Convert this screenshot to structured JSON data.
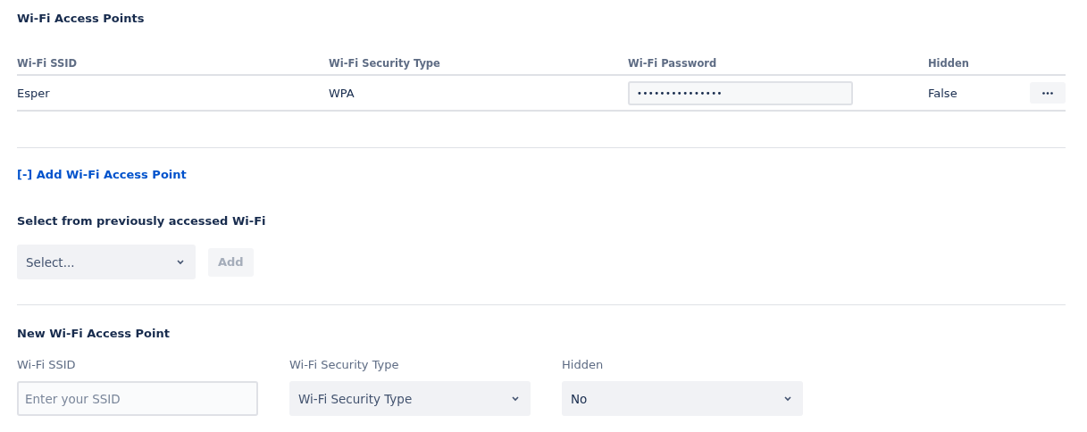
{
  "access_points": {
    "title": "Wi-Fi Access Points",
    "columns": [
      "Wi-Fi SSID",
      "Wi-Fi Security Type",
      "Wi-Fi Password",
      "Hidden"
    ],
    "rows": [
      {
        "ssid": "Esper",
        "security": "WPA",
        "password": "•••••••••••••••",
        "hidden": "False"
      }
    ]
  },
  "add_link": "[-] Add Wi-Fi Access Point",
  "previous": {
    "label": "Select from previously accessed Wi-Fi",
    "select": {
      "placeholder": "Select..."
    },
    "button": {
      "label": "Add",
      "disabled": true
    }
  },
  "new_point": {
    "title": "New Wi-Fi Access Point",
    "fields": [
      {
        "kind": "input",
        "label": "Wi-Fi SSID",
        "placeholder": "Enter your SSID"
      },
      {
        "kind": "select",
        "label": "Wi-Fi Security Type",
        "placeholder": "Wi-Fi Security Type"
      },
      {
        "kind": "select",
        "label": "Hidden",
        "value": "No"
      }
    ]
  }
}
